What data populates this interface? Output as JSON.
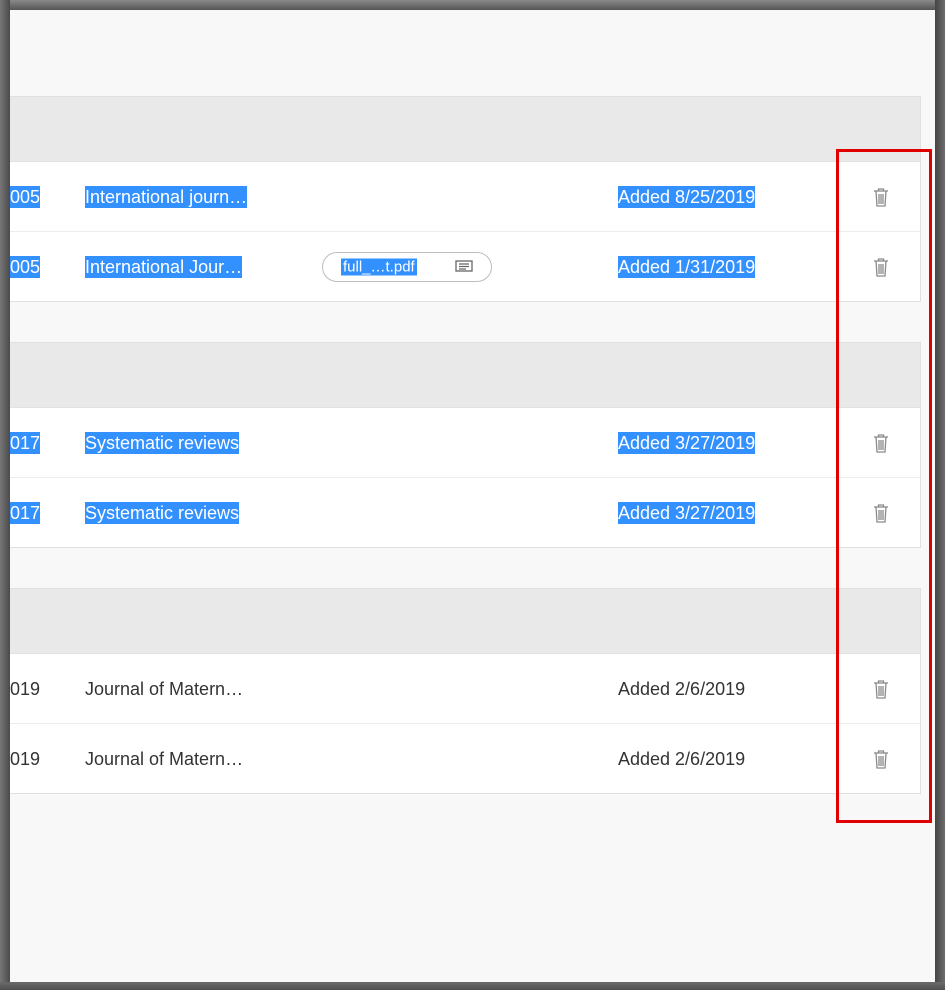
{
  "groups": [
    {
      "rows": [
        {
          "year": "005",
          "journal": "International journ…",
          "added": "Added 8/25/2019",
          "selected": true
        },
        {
          "year": "005",
          "journal": "International Jour…",
          "added": "Added 1/31/2019",
          "selected": true,
          "attachment": "full_…t.pdf"
        }
      ]
    },
    {
      "rows": [
        {
          "year": "017",
          "journal": "Systematic reviews",
          "added": "Added 3/27/2019",
          "selected": true
        },
        {
          "year": "017",
          "journal": "Systematic reviews",
          "added": "Added 3/27/2019",
          "selected": true
        }
      ]
    },
    {
      "rows": [
        {
          "year": "019",
          "journal": "Journal of Matern…",
          "added": "Added 2/6/2019",
          "selected": false
        },
        {
          "year": "019",
          "journal": "Journal of Matern…",
          "added": "Added 2/6/2019",
          "selected": false
        }
      ]
    }
  ],
  "icons": {
    "delete": "trash-icon",
    "attachment_comment": "comment-icon"
  },
  "colors": {
    "selection": "#3390ff",
    "highlight_box": "#e00000"
  }
}
